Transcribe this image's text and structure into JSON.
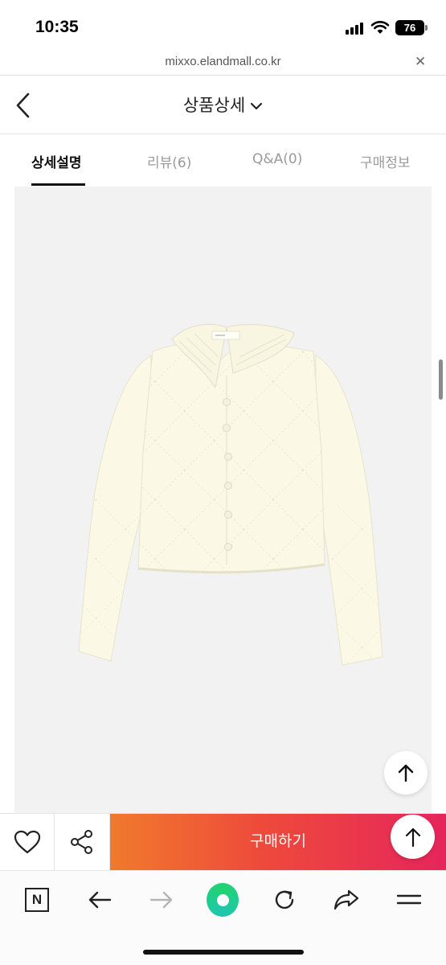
{
  "status_bar": {
    "time": "10:35",
    "battery": "76"
  },
  "browser": {
    "url": "mixxo.elandmall.co.kr",
    "close_symbol": "✕"
  },
  "header": {
    "title": "상품상세"
  },
  "tabs": [
    {
      "label": "상세설명",
      "active": true
    },
    {
      "label": "리뷰(6)",
      "active": false
    },
    {
      "label": "Q&A(0)",
      "active": false
    },
    {
      "label": "구매정보",
      "active": false
    }
  ],
  "product": {
    "image_subject": "cream knit pointelle cardigan with collar",
    "garment_color": "#fbf8e6",
    "background_color": "#f2f2f2"
  },
  "buy_bar": {
    "buy_label": "구매하기",
    "gradient": [
      "#f07a2c",
      "#ee4a3b",
      "#e6255c"
    ]
  },
  "toolbar": {
    "items": [
      "n-icon",
      "back-arrow-icon",
      "forward-arrow-icon",
      "home-dot-icon",
      "refresh-icon",
      "share-arrow-icon",
      "menu-icon"
    ],
    "n_label": "N"
  }
}
